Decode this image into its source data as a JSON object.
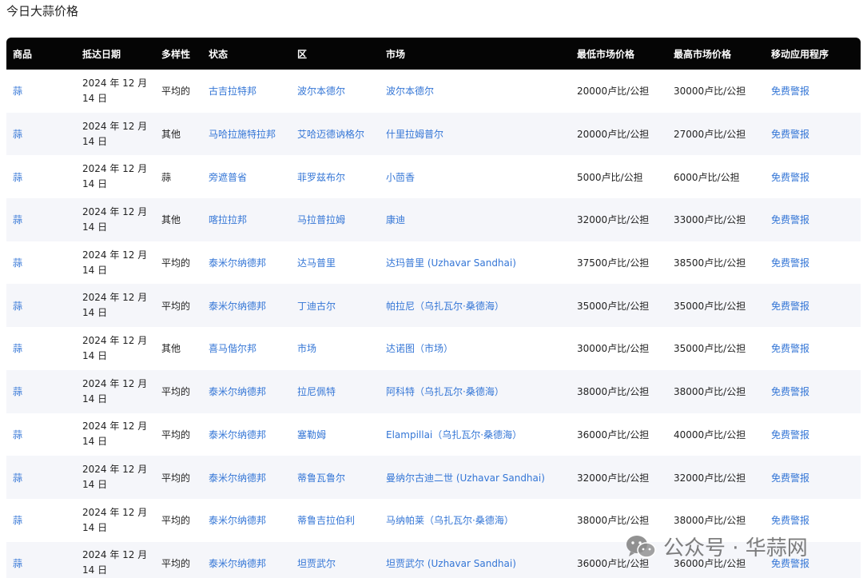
{
  "page": {
    "title": "今日大蒜价格"
  },
  "table": {
    "headers": [
      "商品",
      "抵达日期",
      "多样性",
      "状态",
      "区",
      "市场",
      "最低市场价格",
      "最高市场价格",
      "移动应用程序"
    ],
    "rows": [
      {
        "commodity": "蒜",
        "date": "2024 年 12 月 14 日",
        "variety": "平均的",
        "state": "古吉拉特邦",
        "district": "波尔本德尔",
        "market": "波尔本德尔",
        "min_price": "20000卢比/公担",
        "max_price": "30000卢比/公担",
        "app": "免费警报"
      },
      {
        "commodity": "蒜",
        "date": "2024 年 12 月 14 日",
        "variety": "其他",
        "state": "马哈拉施特拉邦",
        "district": "艾哈迈德讷格尔",
        "market": "什里拉姆普尔",
        "min_price": "20000卢比/公担",
        "max_price": "27000卢比/公担",
        "app": "免费警报"
      },
      {
        "commodity": "蒜",
        "date": "2024 年 12 月 14 日",
        "variety": "蒜",
        "state": "旁遮普省",
        "district": "菲罗兹布尔",
        "market": "小茴香",
        "min_price": "5000卢比/公担",
        "max_price": "6000卢比/公担",
        "app": "免费警报"
      },
      {
        "commodity": "蒜",
        "date": "2024 年 12 月 14 日",
        "variety": "其他",
        "state": "喀拉拉邦",
        "district": "马拉普拉姆",
        "market": "康迪",
        "min_price": "32000卢比/公担",
        "max_price": "33000卢比/公担",
        "app": "免费警报"
      },
      {
        "commodity": "蒜",
        "date": "2024 年 12 月 14 日",
        "variety": "平均的",
        "state": "泰米尔纳德邦",
        "district": "达马普里",
        "market": "达玛普里 (Uzhavar Sandhai)",
        "min_price": "37500卢比/公担",
        "max_price": "38500卢比/公担",
        "app": "免费警报"
      },
      {
        "commodity": "蒜",
        "date": "2024 年 12 月 14 日",
        "variety": "平均的",
        "state": "泰米尔纳德邦",
        "district": "丁迪古尔",
        "market": "帕拉尼（乌扎瓦尔·桑德海）",
        "min_price": "35000卢比/公担",
        "max_price": "35000卢比/公担",
        "app": "免费警报"
      },
      {
        "commodity": "蒜",
        "date": "2024 年 12 月 14 日",
        "variety": "其他",
        "state": "喜马偕尔邦",
        "district": "市场",
        "market": "达诺图（市场）",
        "min_price": "30000卢比/公担",
        "max_price": "35000卢比/公担",
        "app": "免费警报"
      },
      {
        "commodity": "蒜",
        "date": "2024 年 12 月 14 日",
        "variety": "平均的",
        "state": "泰米尔纳德邦",
        "district": "拉尼佩特",
        "market": "阿科特（乌扎瓦尔·桑德海）",
        "min_price": "38000卢比/公担",
        "max_price": "38000卢比/公担",
        "app": "免费警报"
      },
      {
        "commodity": "蒜",
        "date": "2024 年 12 月 14 日",
        "variety": "平均的",
        "state": "泰米尔纳德邦",
        "district": "塞勒姆",
        "market": "Elampillai（乌扎瓦尔·桑德海）",
        "min_price": "36000卢比/公担",
        "max_price": "40000卢比/公担",
        "app": "免费警报"
      },
      {
        "commodity": "蒜",
        "date": "2024 年 12 月 14 日",
        "variety": "平均的",
        "state": "泰米尔纳德邦",
        "district": "蒂鲁瓦鲁尔",
        "market": "曼纳尔古迪二世 (Uzhavar Sandhai)",
        "min_price": "32000卢比/公担",
        "max_price": "32000卢比/公担",
        "app": "免费警报"
      },
      {
        "commodity": "蒜",
        "date": "2024 年 12 月 14 日",
        "variety": "平均的",
        "state": "泰米尔纳德邦",
        "district": "蒂鲁吉拉伯利",
        "market": "马纳帕莱（乌扎瓦尔·桑德海）",
        "min_price": "38000卢比/公担",
        "max_price": "38000卢比/公担",
        "app": "免费警报"
      },
      {
        "commodity": "蒜",
        "date": "2024 年 12 月 14 日",
        "variety": "平均的",
        "state": "泰米尔纳德邦",
        "district": "坦贾武尔",
        "market": "坦贾武尔 (Uzhavar Sandhai)",
        "min_price": "36000卢比/公担",
        "max_price": "36000卢比/公担",
        "app": "免费警报"
      }
    ]
  },
  "watermark": {
    "icon": "wechat-icon",
    "text": "公众号 · 华蒜网"
  }
}
